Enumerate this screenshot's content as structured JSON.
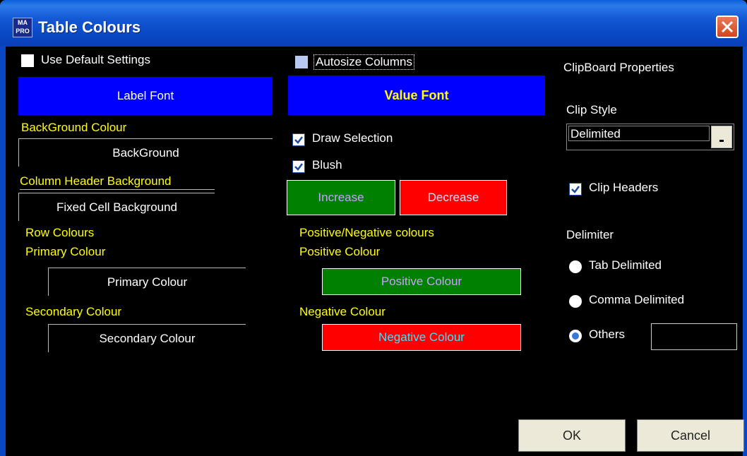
{
  "window": {
    "title": "Table Colours",
    "icon_text": "MA PRO"
  },
  "left": {
    "use_default_settings": "Use Default Settings",
    "label_font": "Label Font",
    "background_colour_label": "BackGround Colour",
    "background_value": "BackGround",
    "column_header_label": "Column Header Background",
    "fixed_cell_value": "Fixed Cell Background",
    "row_colours_label": "Row Colours",
    "primary_colour_label": "Primary Colour",
    "primary_colour_value": "Primary Colour",
    "secondary_colour_label": "Secondary Colour",
    "secondary_colour_value": "Secondary Colour"
  },
  "middle": {
    "autosize_columns": "Autosize Columns",
    "value_font": "Value Font",
    "draw_selection": "Draw Selection",
    "blush": "Blush",
    "increase": "Increase",
    "decrease": "Decrease",
    "pos_neg_label": "Positive/Negative colours",
    "positive_colour_label": "Positive Colour",
    "positive_colour_value": "Positive Colour",
    "negative_colour_label": "Negative Colour",
    "negative_colour_value": "Negative Colour"
  },
  "right": {
    "clipboard_properties": "ClipBoard Properties",
    "clip_style_label": "Clip Style",
    "clip_style_value": "Delimited",
    "clip_headers": "Clip Headers",
    "delimiter_label": "Delimiter",
    "tab_delimited": "Tab Delimited",
    "comma_delimited": "Comma Delimited",
    "others": "Others",
    "others_value": ""
  },
  "buttons": {
    "ok": "OK",
    "cancel": "Cancel"
  },
  "colors": {
    "blue": "#0000ff",
    "green": "#008000",
    "red": "#ff0000",
    "yellow": "#ffff00"
  }
}
